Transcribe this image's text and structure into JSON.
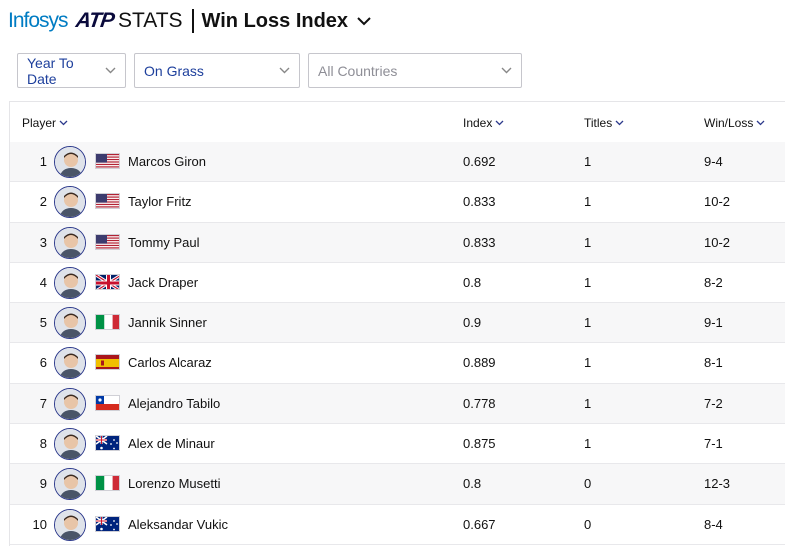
{
  "header": {
    "brand_infosys": "Infosys",
    "brand_atp": "ATP",
    "brand_stats": "STATS",
    "title": "Win Loss Index"
  },
  "filters": {
    "period": "Year To Date",
    "surface": "On Grass",
    "country_placeholder": "All Countries"
  },
  "table": {
    "columns": {
      "player": "Player",
      "index": "Index",
      "titles": "Titles",
      "winloss": "Win/Loss"
    },
    "rows": [
      {
        "rank": "1",
        "name": "Marcos Giron",
        "flag": "usa",
        "index": "0.692",
        "titles": "1",
        "winloss": "9-4"
      },
      {
        "rank": "2",
        "name": "Taylor Fritz",
        "flag": "usa",
        "index": "0.833",
        "titles": "1",
        "winloss": "10-2"
      },
      {
        "rank": "3",
        "name": "Tommy Paul",
        "flag": "usa",
        "index": "0.833",
        "titles": "1",
        "winloss": "10-2"
      },
      {
        "rank": "4",
        "name": "Jack Draper",
        "flag": "gbr",
        "index": "0.8",
        "titles": "1",
        "winloss": "8-2"
      },
      {
        "rank": "5",
        "name": "Jannik Sinner",
        "flag": "ita",
        "index": "0.9",
        "titles": "1",
        "winloss": "9-1"
      },
      {
        "rank": "6",
        "name": "Carlos Alcaraz",
        "flag": "esp",
        "index": "0.889",
        "titles": "1",
        "winloss": "8-1"
      },
      {
        "rank": "7",
        "name": "Alejandro Tabilo",
        "flag": "chi",
        "index": "0.778",
        "titles": "1",
        "winloss": "7-2"
      },
      {
        "rank": "8",
        "name": "Alex de Minaur",
        "flag": "aus",
        "index": "0.875",
        "titles": "1",
        "winloss": "7-1"
      },
      {
        "rank": "9",
        "name": "Lorenzo Musetti",
        "flag": "ita",
        "index": "0.8",
        "titles": "0",
        "winloss": "12-3"
      },
      {
        "rank": "10",
        "name": "Aleksandar Vukic",
        "flag": "aus",
        "index": "0.667",
        "titles": "0",
        "winloss": "8-4"
      }
    ]
  },
  "colors": {
    "accent_blue": "#1d3f9c",
    "infosys_blue": "#007cc3",
    "row_alt": "#f7f7f8"
  },
  "icons": {
    "chevron": "chevron-down-icon",
    "avatar": "player-avatar-icon"
  }
}
